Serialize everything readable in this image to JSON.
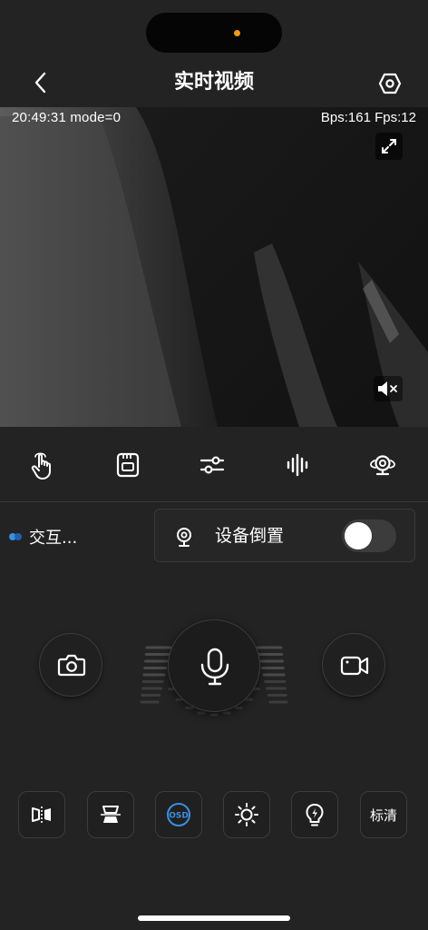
{
  "header": {
    "title": "实时视频",
    "back_icon": "chevron-left-icon",
    "settings_icon": "hexagon-gear-icon"
  },
  "video": {
    "osd_left": "20:49:31 mode=0",
    "osd_right": "Bps:161 Fps:12",
    "fullscreen_icon": "expand-icon",
    "mute_icon": "speaker-muted-icon"
  },
  "toolbar": {
    "items": [
      {
        "icon": "touch-hand-icon"
      },
      {
        "icon": "sd-card-icon"
      },
      {
        "icon": "sliders-icon"
      },
      {
        "icon": "sound-wave-icon"
      },
      {
        "icon": "ptz-camera-icon"
      }
    ]
  },
  "interaction": {
    "label": "交互..."
  },
  "flip": {
    "label": "设备倒置",
    "enabled": false
  },
  "controls": {
    "snapshot_icon": "camera-icon",
    "mic_icon": "microphone-icon",
    "record_icon": "video-camera-icon"
  },
  "bottom_bar": {
    "items": [
      {
        "icon": "mirror-icon"
      },
      {
        "icon": "flip-vertical-icon"
      },
      {
        "icon": "osd-icon",
        "text": "OSD"
      },
      {
        "icon": "brightness-icon"
      },
      {
        "icon": "light-bulb-icon"
      },
      {
        "label": "标清"
      }
    ]
  },
  "colors": {
    "background": "#232323",
    "accent": "#3a8fe0",
    "indicator": "#f59a1b"
  }
}
